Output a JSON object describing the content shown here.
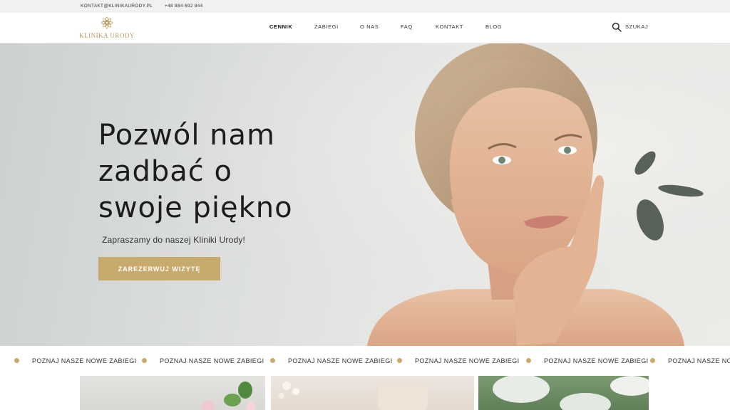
{
  "topbar": {
    "email": "KONTAKT@KLINIKAURODY.PL",
    "phone": "+48 884 692 844"
  },
  "logo": {
    "text": "KLINIKA URODY",
    "color": "#b89a5e"
  },
  "nav": {
    "items": [
      {
        "label": "CENNIK",
        "active": true
      },
      {
        "label": "ZABIEGI",
        "active": false
      },
      {
        "label": "O NAS",
        "active": false
      },
      {
        "label": "FAQ",
        "active": false
      },
      {
        "label": "KONTAKT",
        "active": false
      },
      {
        "label": "BLOG",
        "active": false
      }
    ],
    "search_label": "SZUKAJ",
    "search_icon": "search-icon"
  },
  "hero": {
    "title_lines": [
      "Pozwól nam",
      "zadbać o",
      "swoje piękno"
    ],
    "subtitle": "Zapraszamy do naszej Kliniki Urody!",
    "cta_label": "ZAREZERWUJ WIZYTĘ",
    "accent_color": "#c8ab6c"
  },
  "marquee": {
    "items": [
      "POZNAJ NASZE NOWE ZABIEGI",
      "POZNAJ NASZE NOWE ZABIEGI",
      "POZNAJ NASZE NOWE ZABIEGI",
      "POZNAJ NASZE NOWE ZABIEGI",
      "POZNAJ NASZE NOWE ZABIEGI",
      "POZNAJ NASZE NOWE ZABIEGI"
    ]
  }
}
